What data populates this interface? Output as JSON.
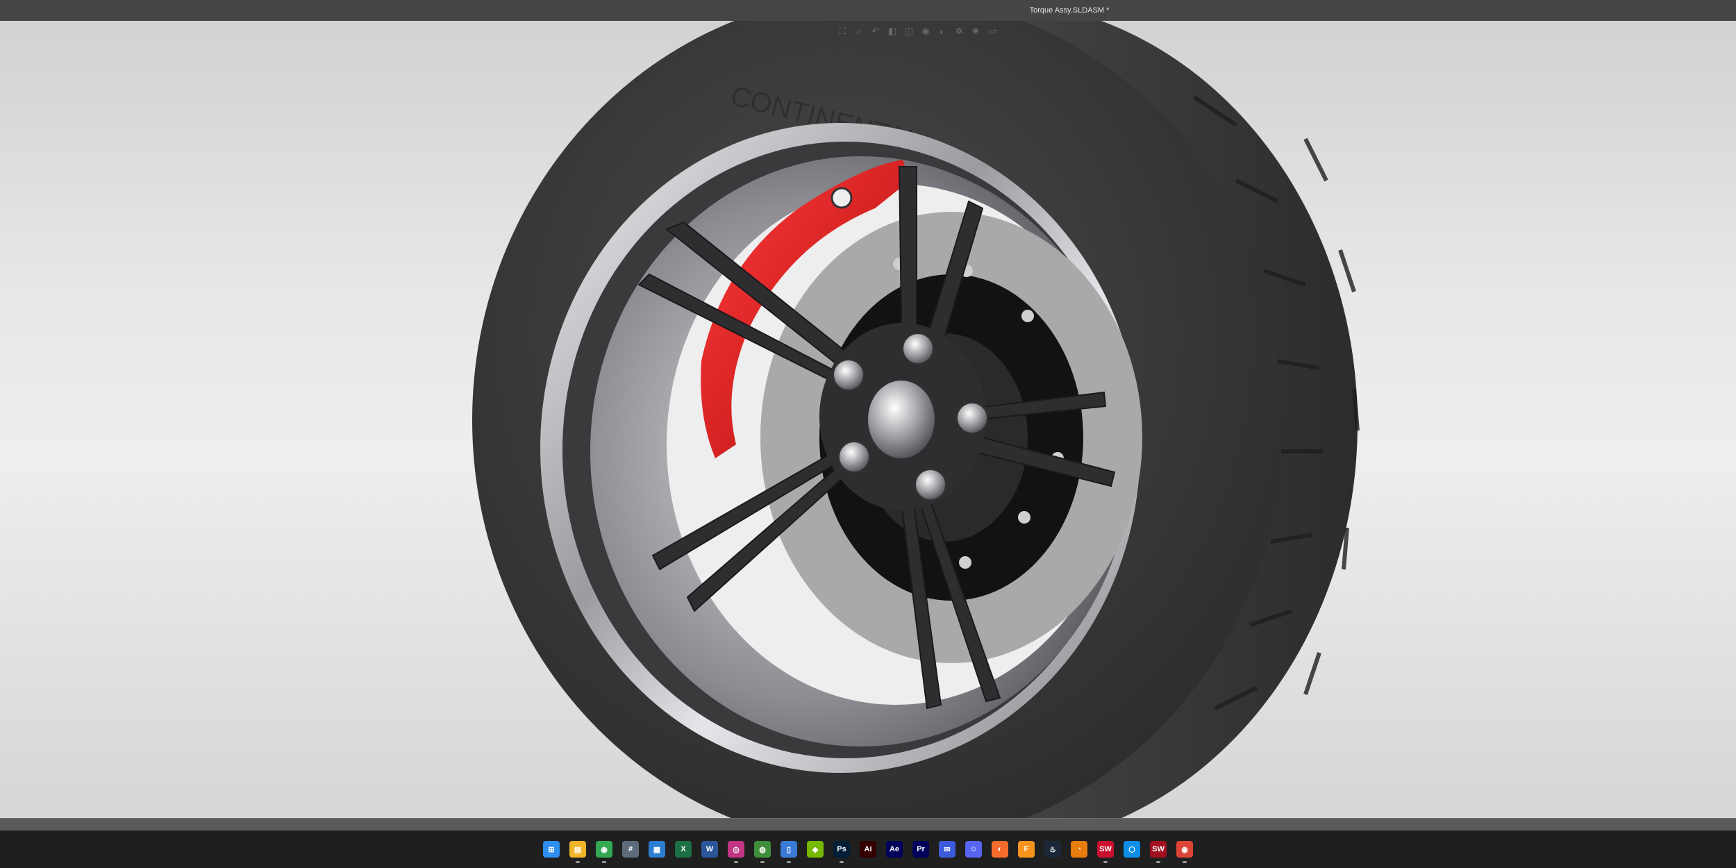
{
  "window": {
    "title": "Torque Assy.SLDASM *"
  },
  "viewport": {
    "label": "3D model viewport",
    "heads_up_toolbar": [
      {
        "name": "zoom-to-fit-icon",
        "glyph": "⛶"
      },
      {
        "name": "zoom-to-area-icon",
        "glyph": "⌕"
      },
      {
        "name": "previous-view-icon",
        "glyph": "↶"
      },
      {
        "name": "section-view-icon",
        "glyph": "◧"
      },
      {
        "name": "view-orientation-icon",
        "glyph": "◫"
      },
      {
        "name": "display-style-icon",
        "glyph": "◉"
      },
      {
        "name": "hide-show-items-icon",
        "glyph": "◐"
      },
      {
        "name": "edit-appearance-icon",
        "glyph": "✲"
      },
      {
        "name": "apply-scene-icon",
        "glyph": "❀"
      },
      {
        "name": "view-settings-icon",
        "glyph": "▭"
      }
    ]
  },
  "colors": {
    "tire": "#3a3a3a",
    "caliper": "#d81414",
    "rim_chrome": "#c9c9cd",
    "spokes": "#2c2c2e",
    "rotor": "#a9a9a9",
    "titlebar": "#454545",
    "taskbar": "#1f1f1f"
  },
  "taskbar": {
    "apps": [
      {
        "name": "windows-start-icon",
        "glyph": "⊞",
        "color": "#2f8ff0",
        "running": false
      },
      {
        "name": "file-explorer-icon",
        "glyph": "▤",
        "color": "#f0b429",
        "running": true
      },
      {
        "name": "chrome-icon",
        "glyph": "◉",
        "color": "#34a853",
        "running": true
      },
      {
        "name": "calculator-icon",
        "glyph": "#",
        "color": "#5d6b7a",
        "running": false
      },
      {
        "name": "calendar-icon",
        "glyph": "▦",
        "color": "#2d7dd2",
        "running": false
      },
      {
        "name": "excel-icon",
        "glyph": "X",
        "color": "#1d7044",
        "running": false
      },
      {
        "name": "word-icon",
        "glyph": "W",
        "color": "#2b579a",
        "running": false
      },
      {
        "name": "instagram-icon",
        "glyph": "◎",
        "color": "#c13584",
        "running": true
      },
      {
        "name": "maps-icon",
        "glyph": "◍",
        "color": "#3f8e3c",
        "running": true
      },
      {
        "name": "phone-link-icon",
        "glyph": "▯",
        "color": "#3a7bd5",
        "running": true
      },
      {
        "name": "nvidia-icon",
        "glyph": "◆",
        "color": "#76b900",
        "running": false
      },
      {
        "name": "photoshop-icon",
        "glyph": "Ps",
        "color": "#001e36",
        "running": true
      },
      {
        "name": "illustrator-icon",
        "glyph": "Ai",
        "color": "#330000",
        "running": false
      },
      {
        "name": "after-effects-icon",
        "glyph": "Ae",
        "color": "#00005b",
        "running": false
      },
      {
        "name": "premiere-icon",
        "glyph": "Pr",
        "color": "#00005b",
        "running": false
      },
      {
        "name": "messenger-icon",
        "glyph": "✉",
        "color": "#3b5bdb",
        "running": false
      },
      {
        "name": "discord-icon",
        "glyph": "☺",
        "color": "#5865f2",
        "running": false
      },
      {
        "name": "origin-icon",
        "glyph": "◐",
        "color": "#f56c2d",
        "running": false
      },
      {
        "name": "fusion-icon",
        "glyph": "F",
        "color": "#f7941d",
        "running": false
      },
      {
        "name": "steam-icon",
        "glyph": "♨",
        "color": "#1b2838",
        "running": false
      },
      {
        "name": "blender-icon",
        "glyph": "◔",
        "color": "#e87d0d",
        "running": false
      },
      {
        "name": "solidworks-icon",
        "glyph": "SW",
        "color": "#c8102e",
        "running": true
      },
      {
        "name": "3d-viewer-icon",
        "glyph": "⬡",
        "color": "#0e8ee9",
        "running": false
      },
      {
        "name": "solidworks-2026-icon",
        "glyph": "SW",
        "color": "#a0101f",
        "running": true
      },
      {
        "name": "chrome-profile-icon",
        "glyph": "◉",
        "color": "#db4437",
        "running": true
      }
    ]
  }
}
